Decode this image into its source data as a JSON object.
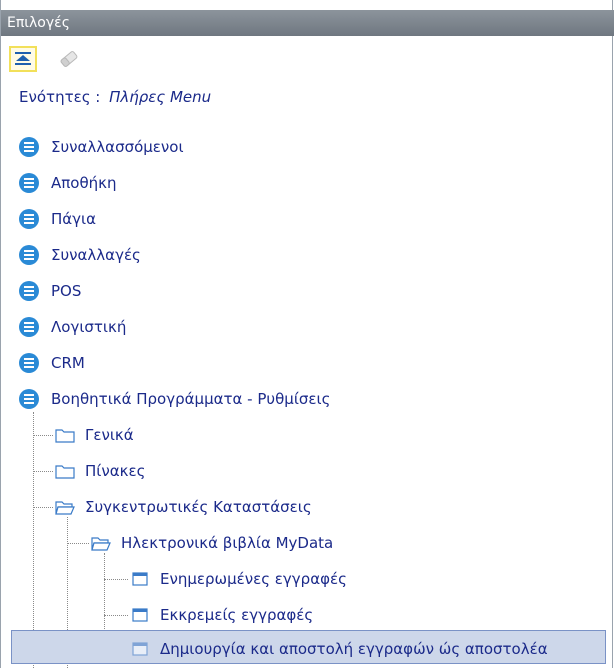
{
  "panel": {
    "title": "Επιλογές"
  },
  "toolbar": {
    "collapse_icon": "collapse-all-icon",
    "eraser_icon": "eraser-icon"
  },
  "sections": {
    "label": "Ενότητες :",
    "value": "Πλήρες Menu"
  },
  "menu": {
    "items": [
      {
        "label": "Συναλλασσόμενοι"
      },
      {
        "label": "Αποθήκη"
      },
      {
        "label": "Πάγια"
      },
      {
        "label": "Συναλλαγές"
      },
      {
        "label": "POS"
      },
      {
        "label": "Λογιστική"
      },
      {
        "label": "CRM"
      },
      {
        "label": "Βοηθητικά Προγράμματα - Ρυθμίσεις"
      }
    ],
    "tree": {
      "general": "Γενικά",
      "tables": "Πίνακες",
      "summaries": "Συγκεντρωτικές Καταστάσεις",
      "mydata": "Ηλεκτρονικά βιβλία MyData",
      "updated": "Ενημερωμένες εγγραφές",
      "pending": "Εκκρεμείς εγγραφές",
      "create_send": "Δημιουργία και αποστολή εγγραφών ώς αποστολέα"
    }
  },
  "colors": {
    "accent": "#2a8ad6",
    "text": "#1b2a8a",
    "selection": "#cdd7ea",
    "titlebar": "#7d858e"
  }
}
